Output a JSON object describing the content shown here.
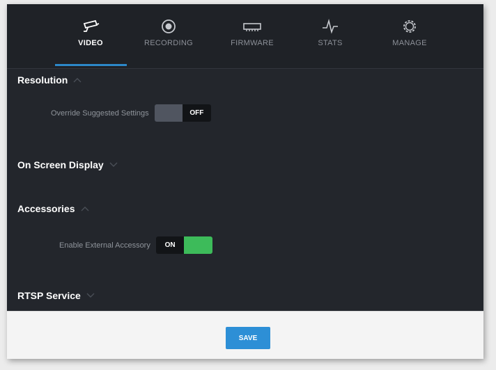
{
  "tabs": [
    {
      "label": "VIDEO",
      "icon": "camera-icon",
      "active": true
    },
    {
      "label": "RECORDING",
      "icon": "record-icon",
      "active": false
    },
    {
      "label": "FIRMWARE",
      "icon": "firmware-icon",
      "active": false
    },
    {
      "label": "STATS",
      "icon": "stats-icon",
      "active": false
    },
    {
      "label": "MANAGE",
      "icon": "gear-icon",
      "active": false
    }
  ],
  "sections": {
    "resolution": {
      "title": "Resolution",
      "expanded": true
    },
    "osd": {
      "title": "On Screen Display",
      "expanded": false
    },
    "accessories": {
      "title": "Accessories",
      "expanded": true
    },
    "rtsp": {
      "title": "RTSP Service",
      "expanded": false
    }
  },
  "settings": {
    "override": {
      "label": "Override Suggested Settings",
      "state_label": "OFF",
      "on": false
    },
    "external_accessory": {
      "label": "Enable External Accessory",
      "state_label": "ON",
      "on": true
    }
  },
  "footer": {
    "save_label": "SAVE"
  },
  "colors": {
    "accent": "#2d8fd6",
    "toggle_on": "#3dbb5a",
    "panel_bg": "#23262c"
  }
}
